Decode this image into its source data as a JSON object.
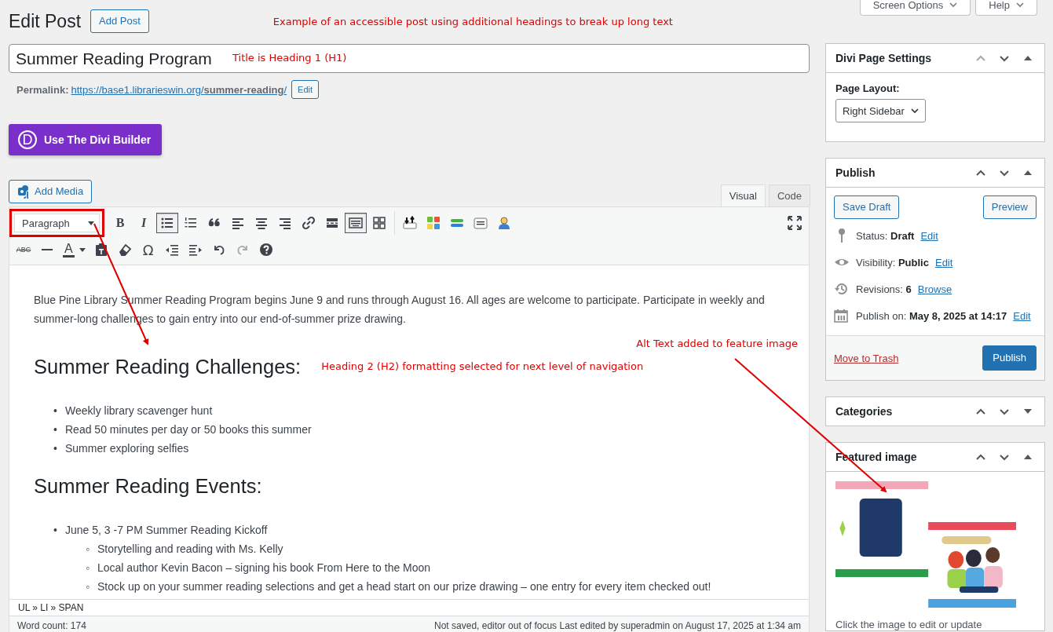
{
  "screen_tabs": [
    {
      "label": "Screen Options"
    },
    {
      "label": "Help"
    }
  ],
  "page_title": "Edit Post",
  "add_button": "Add Post",
  "annotations": {
    "header": "Example of an accessible post using additional headings to break up long text",
    "title": "Title is Heading 1 (H1)",
    "heading": "Heading 2 (H2) formatting selected for next level of navigation",
    "image": "Alt Text added to feature image"
  },
  "title_field": {
    "value": "Summer Reading Program"
  },
  "permalink": {
    "label": "Permalink:",
    "url": "https://base1.librarieswin.org/**summer-reading**/",
    "button": "Edit"
  },
  "divi_button": {
    "logo": "D",
    "label": "Use The Divi Builder"
  },
  "add_media": "Add Media",
  "editor_tabs": [
    {
      "label": "Visual",
      "selected": true
    },
    {
      "label": "Code",
      "selected": false
    }
  ],
  "format_select": {
    "value": "Paragraph"
  },
  "toolbar_rows": [
    [
      {
        "kind": "bold",
        "label": "B",
        "pressed": false
      },
      {
        "kind": "italic",
        "label": "I",
        "pressed": false
      },
      {
        "kind": "bullets",
        "pressed": true
      },
      {
        "kind": "numbers",
        "pressed": false
      },
      {
        "kind": "quote",
        "pressed": false
      },
      {
        "kind": "align-left",
        "pressed": false
      },
      {
        "kind": "align-center",
        "pressed": false
      },
      {
        "kind": "align-right",
        "pressed": false
      },
      {
        "kind": "link",
        "pressed": false
      },
      {
        "kind": "more",
        "pressed": false
      },
      {
        "kind": "keyboard",
        "pressed": true
      },
      {
        "kind": "grid",
        "pressed": false
      },
      {
        "kind": "sep"
      },
      {
        "kind": "updown",
        "pressed": false
      },
      {
        "kind": "blocks",
        "pressed": false
      },
      {
        "kind": "bars",
        "pressed": false
      },
      {
        "kind": "box",
        "pressed": false
      },
      {
        "kind": "person",
        "pressed": false
      }
    ],
    [
      {
        "kind": "strike",
        "label": "ABC",
        "pressed": false
      },
      {
        "kind": "hr",
        "pressed": false
      },
      {
        "kind": "color",
        "label": "A",
        "pressed": false
      },
      {
        "kind": "paste",
        "pressed": false
      },
      {
        "kind": "eraser",
        "pressed": false
      },
      {
        "kind": "char",
        "label": "Ω",
        "pressed": false
      },
      {
        "kind": "outdent",
        "pressed": false
      },
      {
        "kind": "indent",
        "pressed": false
      },
      {
        "kind": "undo",
        "pressed": false
      },
      {
        "kind": "redo",
        "pressed": false,
        "disabled": true
      },
      {
        "kind": "help",
        "pressed": false
      }
    ]
  ],
  "content": [
    {
      "kind": "paragraph",
      "text": "Blue Pine Library Summer Reading Program begins June 9 and runs through August 16. All ages are welcome to participate. Participate in weekly and summer-long challenges to gain entry into our end-of-summer prize drawing."
    },
    {
      "kind": "heading",
      "text": "Summer Reading Challenges:"
    },
    {
      "kind": "list",
      "marker": "•",
      "items": [
        {
          "text": "Weekly library scavenger hunt"
        },
        {
          "text": "Read 50 minutes per day or 50 books this summer"
        },
        {
          "text": "Summer exploring selfies"
        }
      ]
    },
    {
      "kind": "heading",
      "text": "Summer Reading Events:"
    },
    {
      "kind": "list",
      "marker": "•",
      "child_marker": "◦",
      "items": [
        {
          "text": "June 5, 3 -7 PM Summer Reading Kickoff",
          "children": [
            {
              "text": "Storytelling and reading with Ms. Kelly"
            },
            {
              "text": "Local author Kevin Bacon – signing his book From Here to the Moon"
            },
            {
              "text": "Stock up on your summer reading selections and get a head start on our prize drawing – one entry for every item checked out!"
            }
          ]
        }
      ]
    }
  ],
  "path": "UL » LI » SPAN",
  "word_count": "Word count: 174",
  "save_status": "Not saved, editor out of focus Last edited by superadmin on August 17, 2025 at 1:34 am",
  "sidebar": [
    {
      "kind": "divi",
      "title": "Divi Page Settings",
      "expanded": true,
      "field_label": "Page Layout:",
      "select": "Right Sidebar"
    },
    {
      "kind": "publish",
      "title": "Publish",
      "expanded": true,
      "save_draft": "Save Draft",
      "preview": "Preview",
      "rows": [
        {
          "kind": "status",
          "text": "Status: **Draft**",
          "link": "Edit"
        },
        {
          "kind": "visibility",
          "text": "Visibility: **Public**",
          "link": "Edit"
        },
        {
          "kind": "revisions",
          "text": "Revisions: **6**",
          "link": "Browse"
        },
        {
          "kind": "schedule",
          "text": "Publish on: **May 8, 2025 at 14:17**",
          "link": "Edit"
        }
      ],
      "trash": "Move to Trash",
      "publish": "Publish"
    },
    {
      "kind": "categories",
      "title": "Categories",
      "expanded": false
    },
    {
      "kind": "featured",
      "title": "Featured image",
      "expanded": true,
      "hint": "Click the image to edit or update"
    }
  ]
}
